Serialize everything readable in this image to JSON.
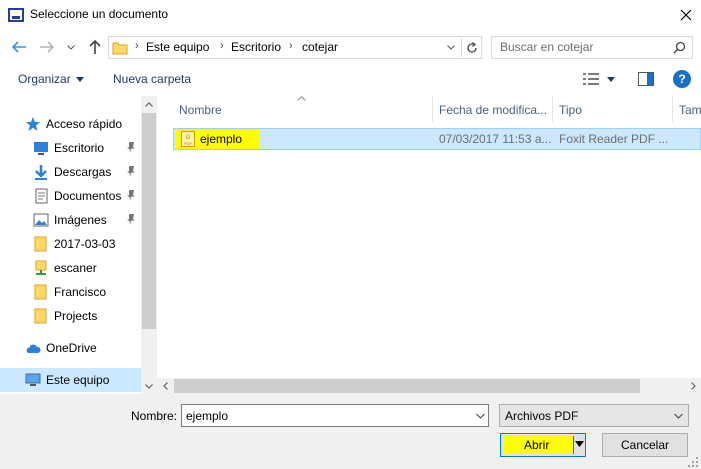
{
  "window": {
    "title": "Seleccione un documento"
  },
  "address": {
    "breadcrumbs": [
      "Este equipo",
      "Escritorio",
      "cotejar"
    ],
    "separator": "›"
  },
  "search": {
    "placeholder": "Buscar en cotejar"
  },
  "toolbar": {
    "organize": "Organizar",
    "new_folder": "Nueva carpeta",
    "help": "?"
  },
  "nav": {
    "items": [
      {
        "label": "Acceso rápido",
        "icon": "star-icon",
        "pinned": false
      },
      {
        "label": "Escritorio",
        "icon": "desktop-icon",
        "pinned": true
      },
      {
        "label": "Descargas",
        "icon": "download-icon",
        "pinned": true
      },
      {
        "label": "Documentos",
        "icon": "documents-icon",
        "pinned": true
      },
      {
        "label": "Imágenes",
        "icon": "pictures-icon",
        "pinned": true
      },
      {
        "label": "2017-03-03",
        "icon": "folder-icon",
        "pinned": false
      },
      {
        "label": "escaner",
        "icon": "network-folder-icon",
        "pinned": false
      },
      {
        "label": "Francisco",
        "icon": "folder-icon",
        "pinned": false
      },
      {
        "label": "Projects",
        "icon": "folder-icon",
        "pinned": false
      },
      {
        "label": "OneDrive",
        "icon": "cloud-icon",
        "pinned": false
      },
      {
        "label": "Este equipo",
        "icon": "computer-icon",
        "pinned": false,
        "selected": true
      }
    ]
  },
  "files": {
    "columns": [
      "Nombre",
      "Fecha de modifica...",
      "Tipo",
      "Tam"
    ],
    "rows": [
      {
        "name": "ejemplo",
        "date": "07/03/2017 11:53 a...",
        "type": "Foxit Reader PDF ...",
        "icon": "pdf-file-icon",
        "selected": true
      }
    ]
  },
  "footer": {
    "name_label": "Nombre:",
    "name_value": "ejemplo",
    "file_type": "Archivos  PDF",
    "open": "Abrir",
    "cancel": "Cancelar"
  },
  "colors": {
    "accent": "#0078d7",
    "selection": "#cce8ff",
    "highlight": "#ffff00"
  }
}
